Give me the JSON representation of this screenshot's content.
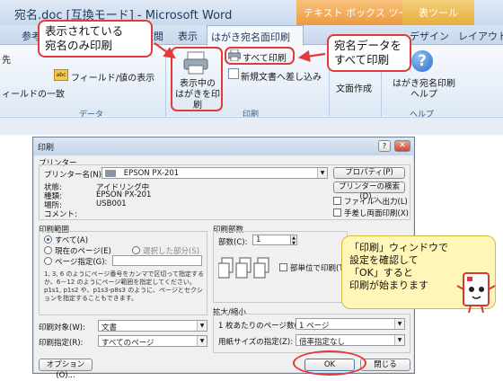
{
  "ribbon": {
    "window_title": "宛名.doc [互換モード] - Microsoft Word",
    "ctx_text_tools": "テキスト ボックス ツール",
    "ctx_table_tools": "表ツール",
    "tabs": [
      "参考",
      "校閲",
      "表示",
      "はがき宛名面印刷",
      "デザイン",
      "レイアウト"
    ],
    "left_items": [
      "先",
      "ィールドの一致"
    ],
    "field_value_btn": "フィールド/値の表示",
    "data_group": "データ",
    "print_current_btn": "表示中の\nはがきを印刷",
    "print_all_btn": "すべて印刷",
    "new_doc_btn": "新規文書へ差し込み",
    "print_group": "印刷",
    "address_create_btn": "文面作成",
    "help_btn": "はがき宛名印刷\nヘルプ",
    "help_group": "ヘルプ"
  },
  "callouts": {
    "left": "表示されている\n宛名のみ印刷",
    "right": "宛名データを\nすべて印刷"
  },
  "dialog": {
    "title": "印刷",
    "printer_section": "プリンター",
    "printer_name_label": "プリンター名(N):",
    "printer_name_value": "EPSON PX-201",
    "properties_btn": "プロパティ(P)",
    "find_printer_btn": "プリンターの検索(D)...",
    "status_label": "状態:",
    "status_value": "アイドリング中",
    "type_label": "種類:",
    "type_value": "EPSON PX-201",
    "location_label": "場所:",
    "location_value": "USB001",
    "comment_label": "コメント:",
    "print_to_file": "ファイルへ出力(L)",
    "manual_duplex": "手差し両面印刷(X)",
    "range_section": "印刷範囲",
    "range_all": "すべて(A)",
    "range_current": "現在のページ(E)",
    "range_selection": "選択した部分(S)",
    "range_pages": "ページ指定(G):",
    "range_help": "1, 3, 6 のようにページ番号をカンマで区切って指定するか、6－12 のようにページ範囲を指定してください。p1s1, p1s2 や、p1s3-p8s3 のように、ページとセクションを指定することもできます。",
    "copies_section": "印刷部数",
    "copies_label": "部数(C):",
    "copies_value": "1",
    "collate_label": "部単位で印刷(T)",
    "print_what_label": "印刷対象(W):",
    "print_what_value": "文書",
    "print_pages_label": "印刷指定(R):",
    "print_pages_value": "すべてのページ",
    "zoom_section": "拡大/縮小",
    "pages_per_sheet_label": "1 枚あたりのページ数(H):",
    "pages_per_sheet_value": "1 ページ",
    "scale_paper_label": "用紙サイズの指定(Z):",
    "scale_paper_value": "倍率指定なし",
    "options_btn": "オプション(O)...",
    "ok_btn": "OK",
    "close_btn": "閉じる"
  },
  "speech": {
    "text": "「印刷」ウィンドウで\n設定を確認して\n「OK」すると\n印刷が始まります"
  }
}
